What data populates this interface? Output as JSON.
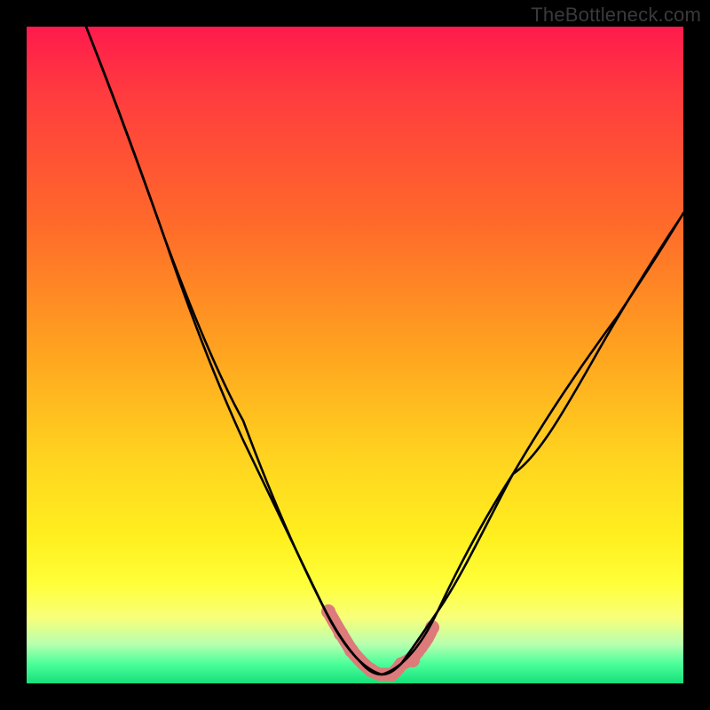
{
  "watermark": "TheBottleneck.com",
  "chart_data": {
    "type": "line",
    "title": "",
    "xlabel": "",
    "ylabel": "",
    "xlim": [
      0,
      1
    ],
    "ylim": [
      0,
      1
    ],
    "series": [
      {
        "name": "bottleneck-black-curve",
        "x": [
          0.09,
          0.13,
          0.17,
          0.21,
          0.25,
          0.29,
          0.33,
          0.37,
          0.41,
          0.45,
          0.49,
          0.51,
          0.54,
          0.57,
          0.596,
          0.625,
          0.66,
          0.7,
          0.74,
          0.78,
          0.82,
          0.86,
          0.9,
          0.94,
          0.98,
          1.0
        ],
        "y": [
          1.0,
          0.9,
          0.79,
          0.68,
          0.57,
          0.47,
          0.37,
          0.28,
          0.2,
          0.12,
          0.05,
          0.03,
          0.01,
          0.01,
          0.02,
          0.05,
          0.11,
          0.19,
          0.27,
          0.345,
          0.42,
          0.49,
          0.56,
          0.625,
          0.685,
          0.716
        ]
      },
      {
        "name": "bottleneck-pink-spots",
        "x": [
          0.46,
          0.478,
          0.495,
          0.51,
          0.525,
          0.54,
          0.555,
          0.57,
          0.587,
          0.6,
          0.618
        ],
        "y": [
          0.11,
          0.075,
          0.05,
          0.03,
          0.02,
          0.014,
          0.014,
          0.02,
          0.035,
          0.055,
          0.085
        ]
      }
    ],
    "background_gradient": {
      "top_color": "#ff1a4d",
      "bottom_color": "#16e07a"
    }
  }
}
